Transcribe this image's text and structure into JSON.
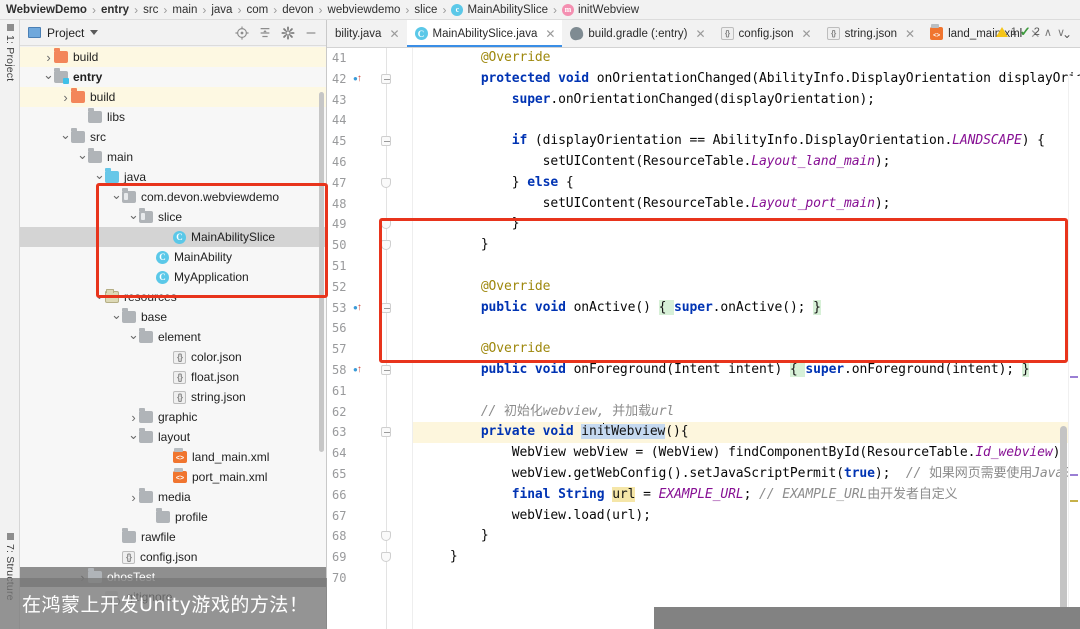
{
  "breadcrumb": [
    {
      "label": "WebviewDemo",
      "bold": true,
      "badge": null
    },
    {
      "label": "entry",
      "bold": true,
      "badge": null
    },
    {
      "label": "src",
      "bold": false,
      "badge": null
    },
    {
      "label": "main",
      "bold": false,
      "badge": null
    },
    {
      "label": "java",
      "bold": false,
      "badge": null
    },
    {
      "label": "com",
      "bold": false,
      "badge": null
    },
    {
      "label": "devon",
      "bold": false,
      "badge": null
    },
    {
      "label": "webviewdemo",
      "bold": false,
      "badge": null
    },
    {
      "label": "slice",
      "bold": false,
      "badge": null
    },
    {
      "label": "MainAbilitySlice",
      "bold": false,
      "badge": "c"
    },
    {
      "label": "initWebview",
      "bold": false,
      "badge": "m"
    }
  ],
  "tool_strip": {
    "top_tab": "1: Project",
    "bottom_tab": "7: Structure"
  },
  "project_panel": {
    "title": "Project",
    "actions": [
      "locate-icon",
      "collapse-all-icon",
      "settings-icon",
      "hide-icon"
    ],
    "tree": [
      {
        "label": "build",
        "indent": 1,
        "arrow": "closed",
        "icon": "folder-orange",
        "style": "hl-build"
      },
      {
        "label": "entry",
        "indent": 1,
        "arrow": "open",
        "icon": "module",
        "bold": true
      },
      {
        "label": "build",
        "indent": 2,
        "arrow": "closed",
        "icon": "folder-orange",
        "style": "hl-build"
      },
      {
        "label": "libs",
        "indent": 3,
        "arrow": "none",
        "icon": "folder"
      },
      {
        "label": "src",
        "indent": 2,
        "arrow": "open",
        "icon": "folder"
      },
      {
        "label": "main",
        "indent": 3,
        "arrow": "open",
        "icon": "folder"
      },
      {
        "label": "java",
        "indent": 4,
        "arrow": "open",
        "icon": "folder-blue"
      },
      {
        "label": "com.devon.webviewdemo",
        "indent": 5,
        "arrow": "open",
        "icon": "pkg"
      },
      {
        "label": "slice",
        "indent": 6,
        "arrow": "open",
        "icon": "pkg"
      },
      {
        "label": "MainAbilitySlice",
        "indent": 8,
        "arrow": "none",
        "icon": "class",
        "style": "selected"
      },
      {
        "label": "MainAbility",
        "indent": 7,
        "arrow": "none",
        "icon": "class"
      },
      {
        "label": "MyApplication",
        "indent": 7,
        "arrow": "none",
        "icon": "class"
      },
      {
        "label": "resources",
        "indent": 4,
        "arrow": "open",
        "icon": "res"
      },
      {
        "label": "base",
        "indent": 5,
        "arrow": "open",
        "icon": "folder"
      },
      {
        "label": "element",
        "indent": 6,
        "arrow": "open",
        "icon": "folder"
      },
      {
        "label": "color.json",
        "indent": 8,
        "arrow": "none",
        "icon": "json"
      },
      {
        "label": "float.json",
        "indent": 8,
        "arrow": "none",
        "icon": "json"
      },
      {
        "label": "string.json",
        "indent": 8,
        "arrow": "none",
        "icon": "json"
      },
      {
        "label": "graphic",
        "indent": 6,
        "arrow": "closed",
        "icon": "folder"
      },
      {
        "label": "layout",
        "indent": 6,
        "arrow": "open",
        "icon": "folder"
      },
      {
        "label": "land_main.xml",
        "indent": 8,
        "arrow": "none",
        "icon": "xml"
      },
      {
        "label": "port_main.xml",
        "indent": 8,
        "arrow": "none",
        "icon": "xml"
      },
      {
        "label": "media",
        "indent": 6,
        "arrow": "closed",
        "icon": "folder"
      },
      {
        "label": "profile",
        "indent": 7,
        "arrow": "none",
        "icon": "folder"
      },
      {
        "label": "rawfile",
        "indent": 5,
        "arrow": "none",
        "icon": "folder"
      },
      {
        "label": "config.json",
        "indent": 5,
        "arrow": "none",
        "icon": "json"
      },
      {
        "label": "ohosTest",
        "indent": 3,
        "arrow": "closed",
        "icon": "folder",
        "style": "dark"
      },
      {
        "label": ".gitignore",
        "indent": 4,
        "arrow": "none",
        "icon": "git"
      }
    ]
  },
  "editor_tabs": [
    {
      "label": "bility.java",
      "icon": "class-icon",
      "active": false,
      "closable": true
    },
    {
      "label": "MainAbilitySlice.java",
      "icon": "class-icon",
      "active": true,
      "closable": true
    },
    {
      "label": "build.gradle (:entry)",
      "icon": "gradle-icon",
      "active": false,
      "closable": true
    },
    {
      "label": "config.json",
      "icon": "json-icon",
      "active": false,
      "closable": true
    },
    {
      "label": "string.json",
      "icon": "json-icon",
      "active": false,
      "closable": true
    },
    {
      "label": "land_main.xml",
      "icon": "xml-icon",
      "active": false,
      "closable": true
    }
  ],
  "inspection": {
    "warning_count": "1",
    "ok_count": "2",
    "prev_label": "∧",
    "next_label": "∨"
  },
  "code": {
    "lines": [
      {
        "num": "41",
        "fold": "none",
        "override": false,
        "current": false,
        "tokens": [
          {
            "t": "        ",
            "c": "plain"
          },
          {
            "t": "@Override",
            "c": "ann"
          }
        ]
      },
      {
        "num": "42",
        "fold": "start",
        "override": true,
        "current": false,
        "tokens": [
          {
            "t": "        ",
            "c": "plain"
          },
          {
            "t": "protected void ",
            "c": "kw"
          },
          {
            "t": "onOrientationChanged(AbilityInfo.DisplayOrientation displayOrientati",
            "c": "plain"
          }
        ]
      },
      {
        "num": "43",
        "fold": "none",
        "override": false,
        "current": false,
        "tokens": [
          {
            "t": "            ",
            "c": "plain"
          },
          {
            "t": "super",
            "c": "kw"
          },
          {
            "t": ".onOrientationChanged(displayOrientation);",
            "c": "plain"
          }
        ]
      },
      {
        "num": "44",
        "fold": "none",
        "override": false,
        "current": false,
        "tokens": []
      },
      {
        "num": "45",
        "fold": "start",
        "override": false,
        "current": false,
        "tokens": [
          {
            "t": "            ",
            "c": "plain"
          },
          {
            "t": "if",
            "c": "kw"
          },
          {
            "t": " (displayOrientation == AbilityInfo.DisplayOrientation.",
            "c": "plain"
          },
          {
            "t": "LANDSCAPE",
            "c": "stat"
          },
          {
            "t": ") {",
            "c": "plain"
          }
        ]
      },
      {
        "num": "46",
        "fold": "none",
        "override": false,
        "current": false,
        "tokens": [
          {
            "t": "                setUIContent(ResourceTable.",
            "c": "plain"
          },
          {
            "t": "Layout_land_main",
            "c": "stat"
          },
          {
            "t": ");",
            "c": "plain"
          }
        ]
      },
      {
        "num": "47",
        "fold": "end",
        "override": false,
        "current": false,
        "tokens": [
          {
            "t": "            } ",
            "c": "plain"
          },
          {
            "t": "else",
            "c": "kw"
          },
          {
            "t": " {",
            "c": "plain"
          }
        ]
      },
      {
        "num": "48",
        "fold": "none",
        "override": false,
        "current": false,
        "tokens": [
          {
            "t": "                setUIContent(ResourceTable.",
            "c": "plain"
          },
          {
            "t": "Layout_port_main",
            "c": "stat"
          },
          {
            "t": ");",
            "c": "plain"
          }
        ]
      },
      {
        "num": "49",
        "fold": "end",
        "override": false,
        "current": false,
        "tokens": [
          {
            "t": "            }",
            "c": "plain"
          }
        ]
      },
      {
        "num": "50",
        "fold": "end",
        "override": false,
        "current": false,
        "tokens": [
          {
            "t": "        }",
            "c": "plain"
          }
        ]
      },
      {
        "num": "51",
        "fold": "none",
        "override": false,
        "current": false,
        "tokens": []
      },
      {
        "num": "52",
        "fold": "none",
        "override": false,
        "current": false,
        "tokens": [
          {
            "t": "        ",
            "c": "plain"
          },
          {
            "t": "@Override",
            "c": "ann"
          }
        ]
      },
      {
        "num": "53",
        "fold": "start",
        "override": true,
        "current": false,
        "tokens": [
          {
            "t": "        ",
            "c": "plain"
          },
          {
            "t": "public void ",
            "c": "kw"
          },
          {
            "t": "onActive() ",
            "c": "plain"
          },
          {
            "t": "{ ",
            "c": "hl-brace"
          },
          {
            "t": "super",
            "c": "kw"
          },
          {
            "t": ".onActive(); ",
            "c": "plain"
          },
          {
            "t": "}",
            "c": "hl-brace"
          }
        ]
      },
      {
        "num": "56",
        "fold": "none",
        "override": false,
        "current": false,
        "tokens": []
      },
      {
        "num": "57",
        "fold": "none",
        "override": false,
        "current": false,
        "tokens": [
          {
            "t": "        ",
            "c": "plain"
          },
          {
            "t": "@Override",
            "c": "ann"
          }
        ]
      },
      {
        "num": "58",
        "fold": "start",
        "override": true,
        "current": false,
        "tokens": [
          {
            "t": "        ",
            "c": "plain"
          },
          {
            "t": "public void ",
            "c": "kw"
          },
          {
            "t": "onForeground(Intent intent) ",
            "c": "plain"
          },
          {
            "t": "{ ",
            "c": "hl-brace"
          },
          {
            "t": "super",
            "c": "kw"
          },
          {
            "t": ".onForeground(intent); ",
            "c": "plain"
          },
          {
            "t": "}",
            "c": "hl-brace"
          }
        ]
      },
      {
        "num": "61",
        "fold": "none",
        "override": false,
        "current": false,
        "tokens": []
      },
      {
        "num": "62",
        "fold": "none",
        "override": false,
        "current": false,
        "tokens": [
          {
            "t": "        ",
            "c": "plain"
          },
          {
            "t": "// ",
            "c": "cmt"
          },
          {
            "t": "初始化",
            "c": "cmt-cn"
          },
          {
            "t": "webview, ",
            "c": "cmt"
          },
          {
            "t": "并加载",
            "c": "cmt-cn"
          },
          {
            "t": "url",
            "c": "cmt"
          }
        ]
      },
      {
        "num": "63",
        "fold": "start",
        "override": false,
        "current": true,
        "tokens": [
          {
            "t": "        ",
            "c": "plain"
          },
          {
            "t": "private void ",
            "c": "kw"
          },
          {
            "t": "ini",
            "c": "hl-sel"
          },
          {
            "t": "|",
            "c": "caret"
          },
          {
            "t": "tWebview",
            "c": "hl-sel"
          },
          {
            "t": "(){",
            "c": "plain"
          }
        ]
      },
      {
        "num": "64",
        "fold": "none",
        "override": false,
        "current": false,
        "tokens": [
          {
            "t": "            WebView webView = (WebView) findComponentById(ResourceTable.",
            "c": "plain"
          },
          {
            "t": "Id_webview",
            "c": "stat"
          },
          {
            "t": ");",
            "c": "plain"
          }
        ]
      },
      {
        "num": "65",
        "fold": "none",
        "override": false,
        "current": false,
        "tokens": [
          {
            "t": "            webView.getWebConfig().setJavaScriptPermit(",
            "c": "plain"
          },
          {
            "t": "true",
            "c": "kw"
          },
          {
            "t": ");  ",
            "c": "plain"
          },
          {
            "t": "// ",
            "c": "cmt"
          },
          {
            "t": "如果网页需要使用",
            "c": "cmt-cn"
          },
          {
            "t": "JavaScript",
            "c": "cmt"
          }
        ]
      },
      {
        "num": "66",
        "fold": "none",
        "override": false,
        "current": false,
        "tokens": [
          {
            "t": "            ",
            "c": "plain"
          },
          {
            "t": "final String ",
            "c": "kw"
          },
          {
            "t": "url",
            "c": "hl-ident"
          },
          {
            "t": " = ",
            "c": "plain"
          },
          {
            "t": "EXAMPLE_URL",
            "c": "stat"
          },
          {
            "t": "; ",
            "c": "plain"
          },
          {
            "t": "// ",
            "c": "cmt"
          },
          {
            "t": "EXAMPLE_URL",
            "c": "cmt"
          },
          {
            "t": "由开发者自定义",
            "c": "cmt-cn"
          }
        ]
      },
      {
        "num": "67",
        "fold": "none",
        "override": false,
        "current": false,
        "tokens": [
          {
            "t": "            webView.load(url);",
            "c": "plain"
          }
        ]
      },
      {
        "num": "68",
        "fold": "end",
        "override": false,
        "current": false,
        "tokens": [
          {
            "t": "        }",
            "c": "plain"
          }
        ]
      },
      {
        "num": "69",
        "fold": "end",
        "override": false,
        "current": false,
        "tokens": [
          {
            "t": "    }",
            "c": "plain"
          }
        ]
      },
      {
        "num": "70",
        "fold": "none",
        "override": false,
        "current": false,
        "tokens": []
      }
    ]
  },
  "caption": {
    "text": "在鸿蒙上开发Unity游戏的方法！"
  },
  "colors": {
    "accent": "#3a8ee6",
    "highlight_box": "#e8341c",
    "current_line": "#fdf6dd",
    "keyword": "#0033b3",
    "annotation": "#9e880d",
    "comment": "#8c8c8c",
    "static_field": "#871094",
    "warning": "#f5c518",
    "ok": "#3c9a3c"
  }
}
